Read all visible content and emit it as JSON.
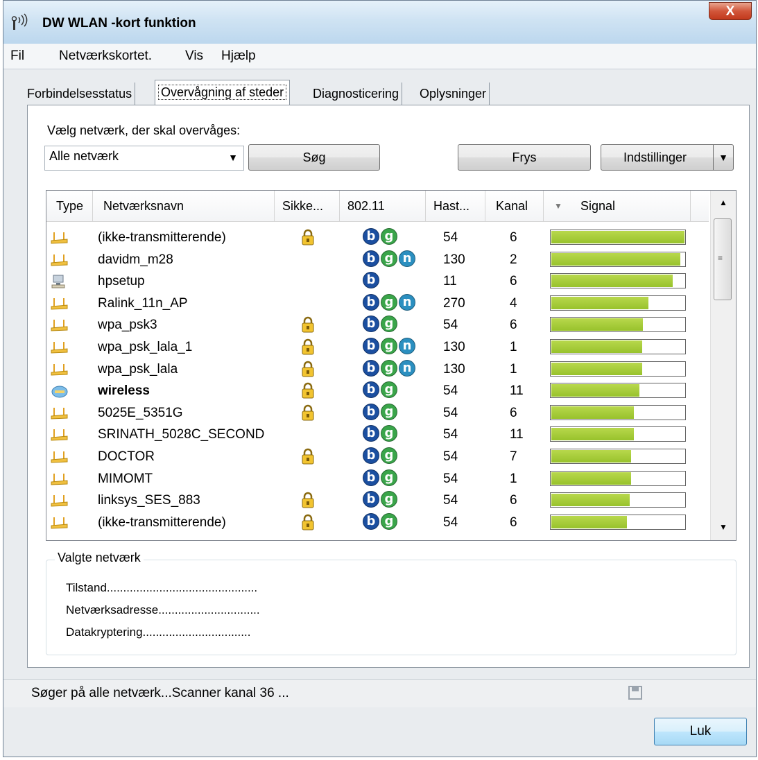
{
  "window": {
    "title": "DW WLAN -kort funktion",
    "close_glyph": "X"
  },
  "menu": [
    "Fil",
    "Netværkskortet.",
    "Vis",
    "Hjælp"
  ],
  "tabs": [
    "Forbindelsesstatus",
    "Overvågning af steder",
    "Diagnosticering",
    "Oplysninger"
  ],
  "active_tab": "Overvågning af steder",
  "select": {
    "label": "Vælg netværk, der skal overvåges:",
    "value": "Alle netværk"
  },
  "buttons": {
    "search": "Søg",
    "freeze": "Frys",
    "settings": "Indstillinger",
    "close": "Luk"
  },
  "columns": [
    "Type",
    "Netværksnavn",
    "Sikke...",
    "802.11",
    "Hast...",
    "Kanal",
    "Signal"
  ],
  "sort_column": "Signal",
  "networks": [
    {
      "type": "router",
      "name": "(ikke-transmitterende)",
      "secure": true,
      "modes": [
        "b",
        "g"
      ],
      "speed": "54",
      "channel": "6",
      "signal": 1.0
    },
    {
      "type": "router",
      "name": "davidm_m28",
      "secure": false,
      "modes": [
        "b",
        "g",
        "n"
      ],
      "speed": "130",
      "channel": "2",
      "signal": 0.97
    },
    {
      "type": "computer",
      "name": "hpsetup",
      "secure": false,
      "modes": [
        "b"
      ],
      "speed": "11",
      "channel": "6",
      "signal": 0.91
    },
    {
      "type": "router",
      "name": "Ralink_11n_AP",
      "secure": false,
      "modes": [
        "b",
        "g",
        "n"
      ],
      "speed": "270",
      "channel": "4",
      "signal": 0.73
    },
    {
      "type": "router",
      "name": "wpa_psk3",
      "secure": true,
      "modes": [
        "b",
        "g"
      ],
      "speed": "54",
      "channel": "6",
      "signal": 0.69
    },
    {
      "type": "router",
      "name": "wpa_psk_lala_1",
      "secure": true,
      "modes": [
        "b",
        "g",
        "n"
      ],
      "speed": "130",
      "channel": "1",
      "signal": 0.68
    },
    {
      "type": "router",
      "name": "wpa_psk_lala",
      "secure": true,
      "modes": [
        "b",
        "g",
        "n"
      ],
      "speed": "130",
      "channel": "1",
      "signal": 0.68
    },
    {
      "type": "connected",
      "name": "wireless",
      "secure": true,
      "modes": [
        "b",
        "g"
      ],
      "speed": "54",
      "channel": "11",
      "signal": 0.66,
      "bold": true
    },
    {
      "type": "router",
      "name": "5025E_5351G",
      "secure": true,
      "modes": [
        "b",
        "g"
      ],
      "speed": "54",
      "channel": "6",
      "signal": 0.62
    },
    {
      "type": "router",
      "name": "SRINATH_5028C_SECOND",
      "secure": false,
      "modes": [
        "b",
        "g"
      ],
      "speed": "54",
      "channel": "11",
      "signal": 0.62
    },
    {
      "type": "router",
      "name": "DOCTOR",
      "secure": true,
      "modes": [
        "b",
        "g"
      ],
      "speed": "54",
      "channel": "7",
      "signal": 0.6
    },
    {
      "type": "router",
      "name": "MIMOMT",
      "secure": false,
      "modes": [
        "b",
        "g"
      ],
      "speed": "54",
      "channel": "1",
      "signal": 0.6
    },
    {
      "type": "router",
      "name": "linksys_SES_883",
      "secure": true,
      "modes": [
        "b",
        "g"
      ],
      "speed": "54",
      "channel": "6",
      "signal": 0.59
    },
    {
      "type": "router",
      "name": "(ikke-transmitterende)",
      "secure": true,
      "modes": [
        "b",
        "g"
      ],
      "speed": "54",
      "channel": "6",
      "signal": 0.57
    }
  ],
  "selected_network": {
    "title": "Valgte netværk",
    "fields": [
      "Tilstand..............................................",
      "Netværksadresse...............................",
      "Datakryptering................................."
    ]
  },
  "status": "Søger på alle netværk...Scanner kanal 36 ...",
  "colors": {
    "b_badge": "#1b4fa0",
    "g_badge": "#3aa54a",
    "n_badge": "#2b8fc0",
    "signal_bar": "#a8cc3a"
  }
}
